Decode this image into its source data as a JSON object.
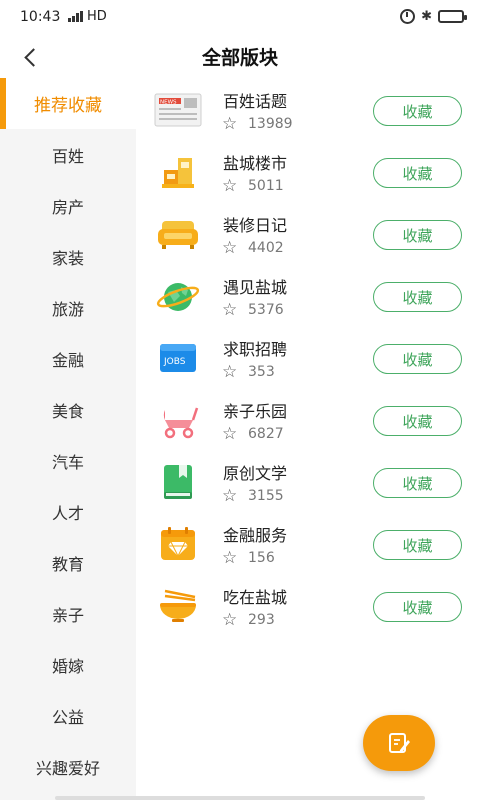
{
  "status_bar": {
    "time": "10:43",
    "network": "HD"
  },
  "header": {
    "title": "全部版块"
  },
  "sidebar": {
    "items": [
      {
        "label": "推荐收藏",
        "active": true
      },
      {
        "label": "百姓"
      },
      {
        "label": "房产"
      },
      {
        "label": "家装"
      },
      {
        "label": "旅游"
      },
      {
        "label": "金融"
      },
      {
        "label": "美食"
      },
      {
        "label": "汽车"
      },
      {
        "label": "人才"
      },
      {
        "label": "教育"
      },
      {
        "label": "亲子"
      },
      {
        "label": "婚嫁"
      },
      {
        "label": "公益"
      },
      {
        "label": "兴趣爱好"
      }
    ]
  },
  "boards": [
    {
      "name": "百姓话题",
      "count": "13989",
      "button": "收藏",
      "icon": "newspaper-icon"
    },
    {
      "name": "盐城楼市",
      "count": "5011",
      "button": "收藏",
      "icon": "buildings-icon"
    },
    {
      "name": "装修日记",
      "count": "4402",
      "button": "收藏",
      "icon": "sofa-icon"
    },
    {
      "name": "遇见盐城",
      "count": "5376",
      "button": "收藏",
      "icon": "globe-icon"
    },
    {
      "name": "求职招聘",
      "count": "353",
      "button": "收藏",
      "icon": "jobs-icon"
    },
    {
      "name": "亲子乐园",
      "count": "6827",
      "button": "收藏",
      "icon": "stroller-icon"
    },
    {
      "name": "原创文学",
      "count": "3155",
      "button": "收藏",
      "icon": "book-icon"
    },
    {
      "name": "金融服务",
      "count": "156",
      "button": "收藏",
      "icon": "diamond-card-icon"
    },
    {
      "name": "吃在盐城",
      "count": "293",
      "button": "收藏",
      "icon": "noodle-bowl-icon"
    }
  ],
  "icons": {
    "jobs_text": "JOBS",
    "news_text": "NEWS"
  },
  "colors": {
    "accent": "#f59a0b",
    "button_green": "#3fa55b",
    "sidebar_bg": "#f5f5f5"
  }
}
